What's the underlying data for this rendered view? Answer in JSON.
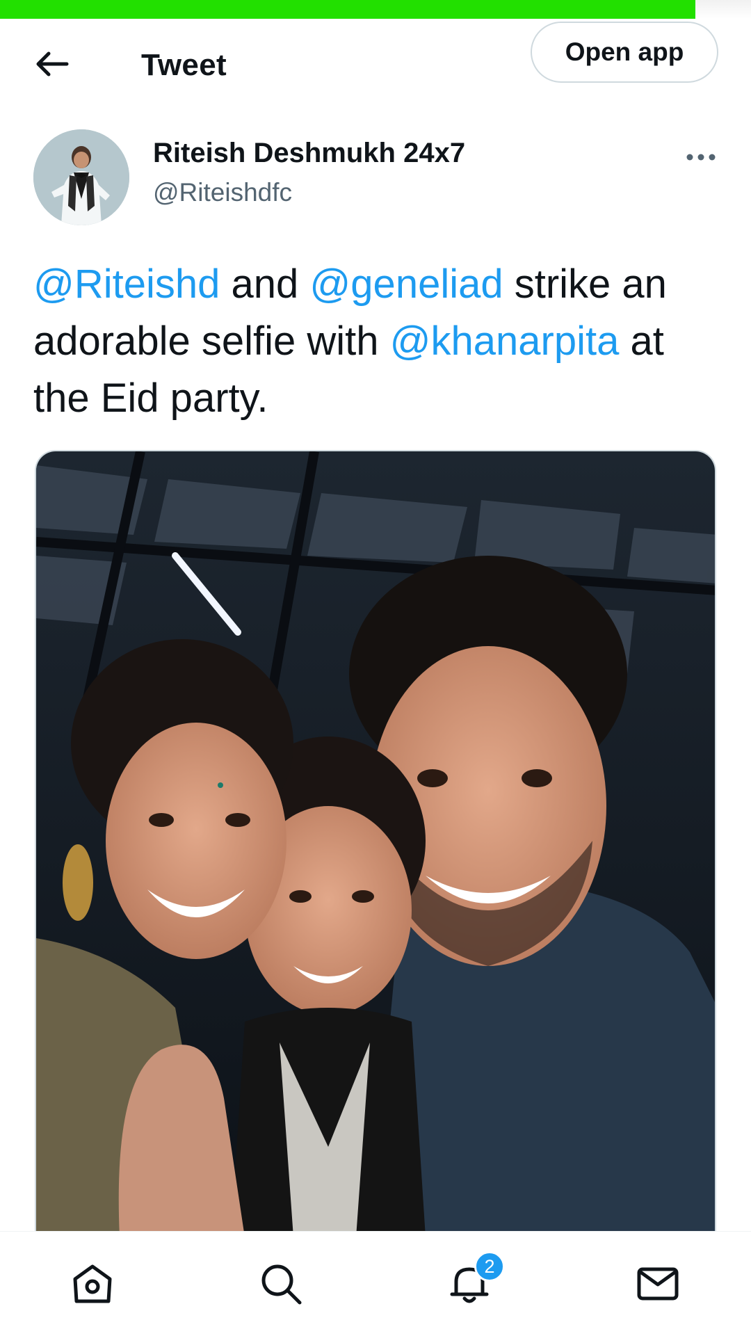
{
  "status": {
    "load_progress_percent": 92.6,
    "accent_color": "#22e000"
  },
  "header": {
    "back_icon": "arrow-left-icon",
    "title": "Tweet",
    "open_app_label": "Open app"
  },
  "tweet": {
    "author": {
      "display_name": "Riteish Deshmukh 24x7",
      "handle": "@Riteishdfc",
      "more_icon": "more-horizontal-icon"
    },
    "text_parts": {
      "mention1": "@Riteishd",
      "t1": " and ",
      "mention2": "@geneliad",
      "t2": " strike an adorable selfie with ",
      "mention3": "@khanarpita",
      "t3": " at the Eid party."
    },
    "mention_color": "#1d9bf0",
    "media_alt": "selfie photo"
  },
  "bottom_nav": {
    "items": [
      {
        "name": "home",
        "icon": "home-icon"
      },
      {
        "name": "search",
        "icon": "search-icon"
      },
      {
        "name": "notifications",
        "icon": "bell-icon",
        "badge": "2"
      },
      {
        "name": "messages",
        "icon": "mail-icon"
      }
    ]
  }
}
